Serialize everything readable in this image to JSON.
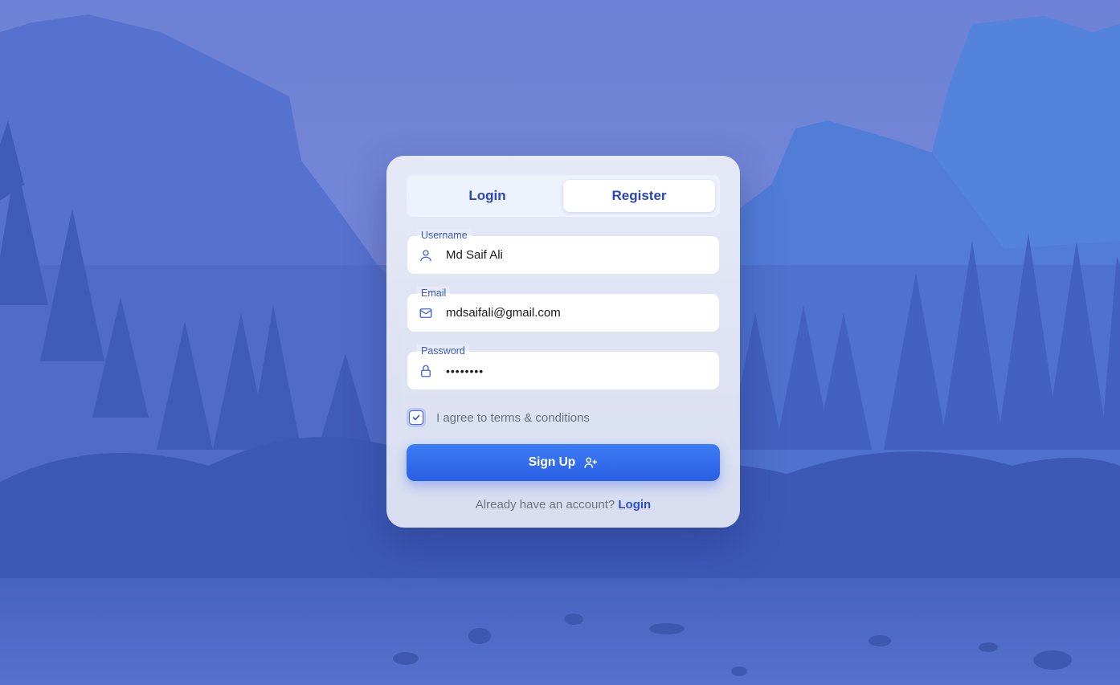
{
  "tabs": {
    "login_label": "Login",
    "register_label": "Register",
    "active": "register"
  },
  "form": {
    "username": {
      "label": "Username",
      "value": "Md Saif Ali",
      "icon": "user-icon"
    },
    "email": {
      "label": "Email",
      "value": "mdsaifali@gmail.com",
      "icon": "mail-icon"
    },
    "password": {
      "label": "Password",
      "value": "••••••••",
      "icon": "lock-icon"
    },
    "agree_text": "I agree to terms & conditions",
    "agree_checked": true,
    "submit_label": "Sign Up",
    "submit_icon": "user-plus-icon"
  },
  "footer": {
    "prompt": "Already have an account?",
    "link_label": "Login"
  },
  "colors": {
    "accent": "#2a5fe4",
    "label": "#3b57c6"
  }
}
